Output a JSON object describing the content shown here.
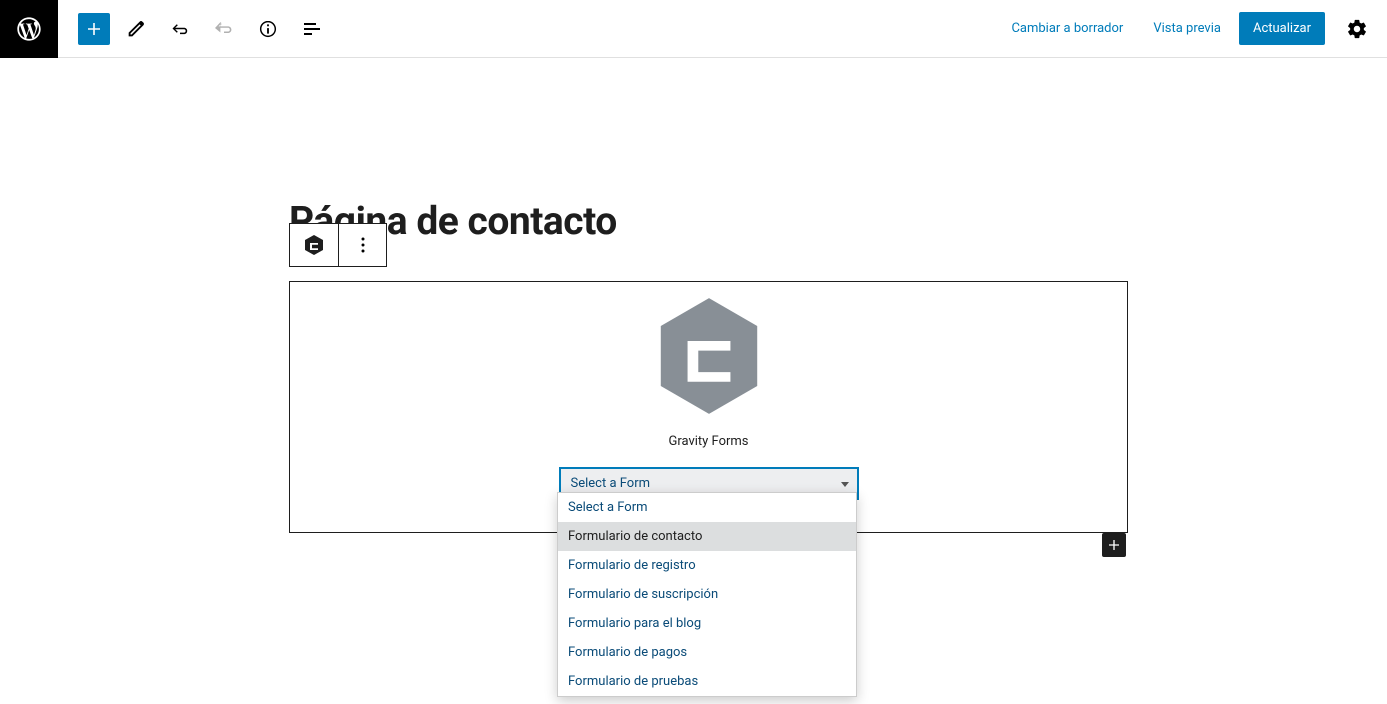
{
  "toolbar": {
    "switch_draft": "Cambiar a borrador",
    "preview": "Vista previa",
    "update": "Actualizar"
  },
  "page": {
    "title": "Página de contacto"
  },
  "block": {
    "label": "Gravity Forms",
    "select_placeholder": "Select a Form"
  },
  "dropdown": {
    "items": [
      "Select a Form",
      "Formulario de contacto",
      "Formulario de registro",
      "Formulario de suscripción",
      "Formulario para el blog",
      "Formulario de pagos",
      "Formulario de pruebas"
    ],
    "hovered_index": 1
  }
}
